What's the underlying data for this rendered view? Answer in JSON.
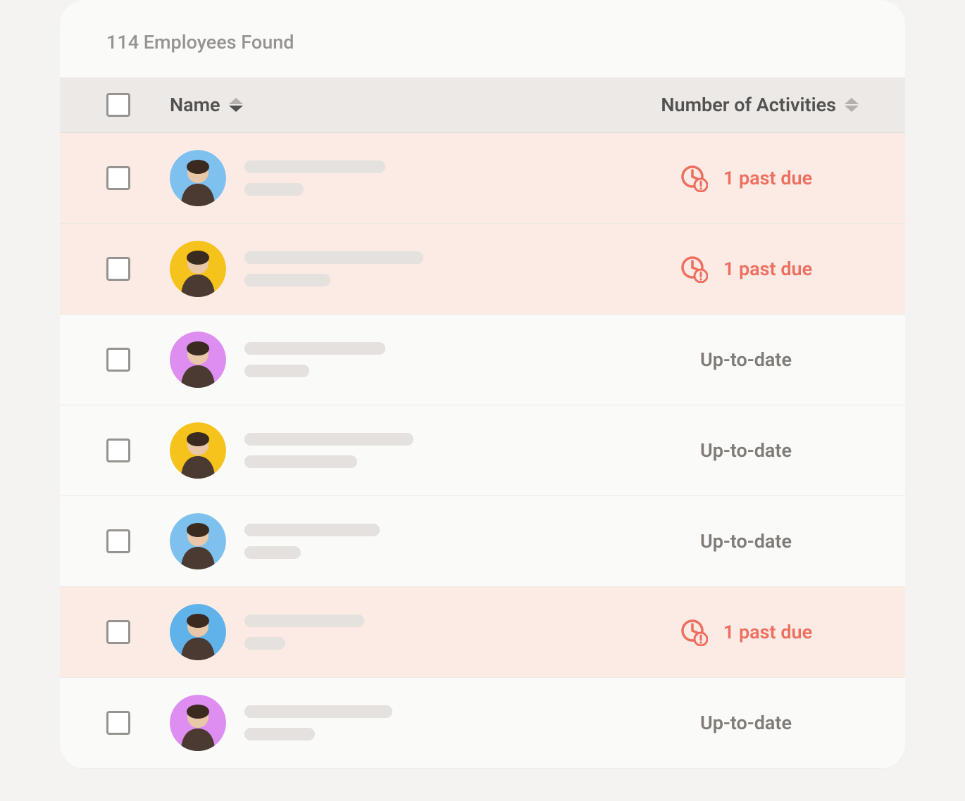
{
  "header": {
    "count_label": "114 Employees Found"
  },
  "columns": {
    "name": "Name",
    "activities": "Number of Activities"
  },
  "status_labels": {
    "past_due": "1 past due",
    "up_to_date": "Up-to-date"
  },
  "rows": [
    {
      "avatar_bg": "#7fc1ee",
      "line1_w": 200,
      "line2_w": 84,
      "status": "past_due"
    },
    {
      "avatar_bg": "#f6c21c",
      "line1_w": 254,
      "line2_w": 122,
      "status": "past_due"
    },
    {
      "avatar_bg": "#dd8ef0",
      "line1_w": 200,
      "line2_w": 92,
      "status": "up_to_date"
    },
    {
      "avatar_bg": "#f6c21c",
      "line1_w": 240,
      "line2_w": 160,
      "status": "up_to_date"
    },
    {
      "avatar_bg": "#7fc1ee",
      "line1_w": 192,
      "line2_w": 80,
      "status": "up_to_date"
    },
    {
      "avatar_bg": "#5fb2ea",
      "line1_w": 170,
      "line2_w": 58,
      "status": "past_due"
    },
    {
      "avatar_bg": "#dd8ef0",
      "line1_w": 210,
      "line2_w": 100,
      "status": "up_to_date"
    }
  ]
}
